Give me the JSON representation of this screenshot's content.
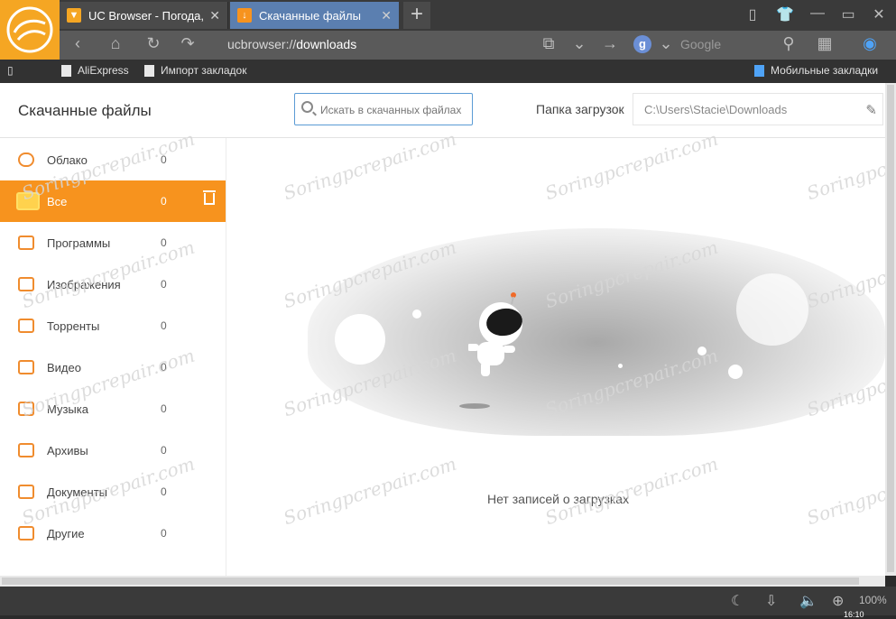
{
  "tabs": [
    {
      "label": "UC Browser - Погода, ",
      "icon": "uc-icon"
    },
    {
      "label": "Скачанные файлы",
      "icon": "download-icon"
    }
  ],
  "address": {
    "scheme": "ucbrowser://",
    "path": "downloads"
  },
  "search_engine": {
    "letter": "g",
    "placeholder": "Google"
  },
  "bookmarks": [
    "AliExpress",
    "Импорт закладок",
    "Мобильные закладки"
  ],
  "page": {
    "title": "Скачанные файлы",
    "search_placeholder": "Искать в скачанных файлах",
    "folder_label": "Папка загрузок",
    "folder_path": "C:\\Users\\Stacie\\Downloads",
    "empty_text": "Нет записей о загрузках"
  },
  "categories": [
    {
      "label": "Облако",
      "count": "0"
    },
    {
      "label": "Все",
      "count": "0"
    },
    {
      "label": "Программы",
      "count": "0"
    },
    {
      "label": "Изображения",
      "count": "0"
    },
    {
      "label": "Торренты",
      "count": "0"
    },
    {
      "label": "Видео",
      "count": "0"
    },
    {
      "label": "Музыка",
      "count": "0"
    },
    {
      "label": "Архивы",
      "count": "0"
    },
    {
      "label": "Документы",
      "count": "0"
    },
    {
      "label": "Другие",
      "count": "0"
    }
  ],
  "status": {
    "zoom": "100%",
    "time": "16:10"
  },
  "watermark": "Soringpcrepair.com",
  "colors": {
    "accent": "#f7931e",
    "active_tab": "#5b7fb0",
    "brand": "#f5a623"
  }
}
